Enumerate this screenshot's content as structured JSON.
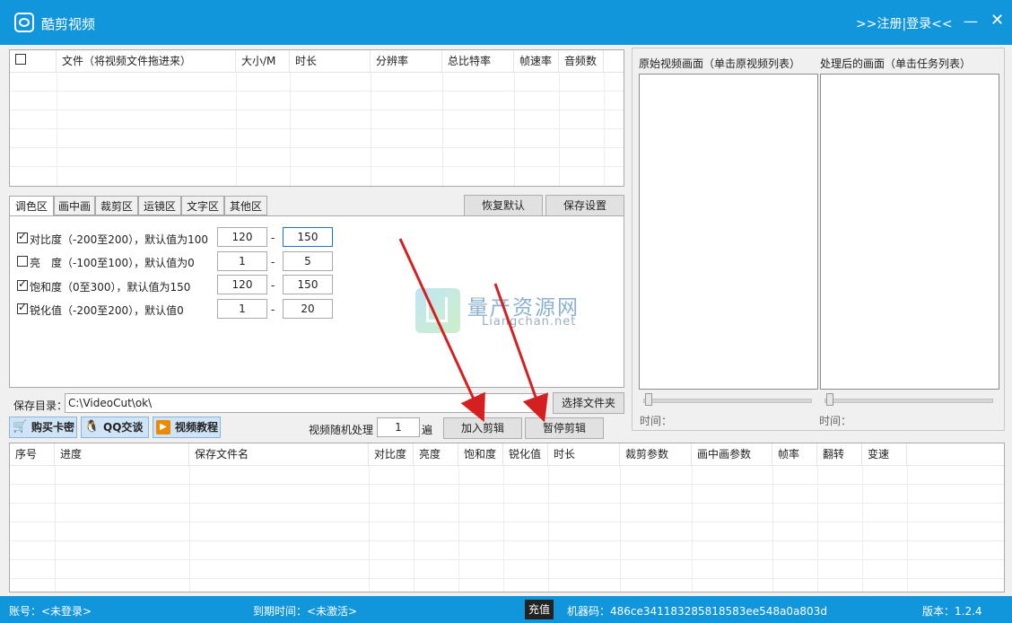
{
  "window": {
    "title": "酷剪视频",
    "login_link": ">>注册|登录<<",
    "minimize_glyph": "—",
    "close_glyph": "✕"
  },
  "file_table": {
    "columns": [
      "文件（将视频文件拖进来）",
      "大小/M",
      "时长",
      "分辨率",
      "总比特率",
      "帧速率",
      "音频数"
    ]
  },
  "tabs": [
    "调色区",
    "画中画",
    "裁剪区",
    "运镜区",
    "文字区",
    "其他区"
  ],
  "tab_buttons": {
    "restore": "恢复默认",
    "save_settings": "保存设置"
  },
  "params": [
    {
      "label": "对比度（-200至200），默认值为100",
      "checked": true,
      "min": "120",
      "max": "150"
    },
    {
      "label": "亮　度（-100至100），默认值为0",
      "checked": false,
      "min": "1",
      "max": "5"
    },
    {
      "label": "饱和度（0至300），默认值为150",
      "checked": true,
      "min": "120",
      "max": "150"
    },
    {
      "label": "锐化值（-200至200），默认值0",
      "checked": true,
      "min": "1",
      "max": "20"
    }
  ],
  "range_separator": "-",
  "preview": {
    "original_label": "原始视频画面（单击原视频列表）",
    "processed_label": "处理后的画面（单击任务列表）",
    "time_label": "时间："
  },
  "save_dir": {
    "label": "保存目录：",
    "value": "C:\\VideoCut\\ok\\",
    "choose_button": "选择文件夹"
  },
  "action_buttons": {
    "buy_card": "购买卡密",
    "qq_chat": "QQ交谈",
    "video_tutorial": "视频教程",
    "random_label": "视频随机处理",
    "random_value": "1",
    "random_unit": "遍",
    "add_edit": "加入剪辑",
    "pause_edit": "暂停剪辑"
  },
  "task_table": {
    "columns": [
      "序号",
      "进度",
      "保存文件名",
      "对比度",
      "亮度",
      "饱和度",
      "锐化值",
      "时长",
      "裁剪参数",
      "画中画参数",
      "帧率",
      "翻转",
      "变速"
    ]
  },
  "status": {
    "account": "账号：<未登录>",
    "expiry": "到期时间：<未激活>",
    "recharge": "充值",
    "machine_code": "机器码：486ce341183285818583ee548a0a803d",
    "version": "版本：1.2.4"
  },
  "watermark": {
    "title": "量产资源网",
    "subtitle": "Liangchan.net"
  },
  "colors": {
    "titlebar": "#1296db",
    "statusbar": "#1296db",
    "arrow": "#d42020"
  },
  "icons": {
    "app": "app-logo-icon",
    "buy": "cart-icon",
    "qq": "qq-penguin-icon",
    "tutorial": "play-icon"
  }
}
